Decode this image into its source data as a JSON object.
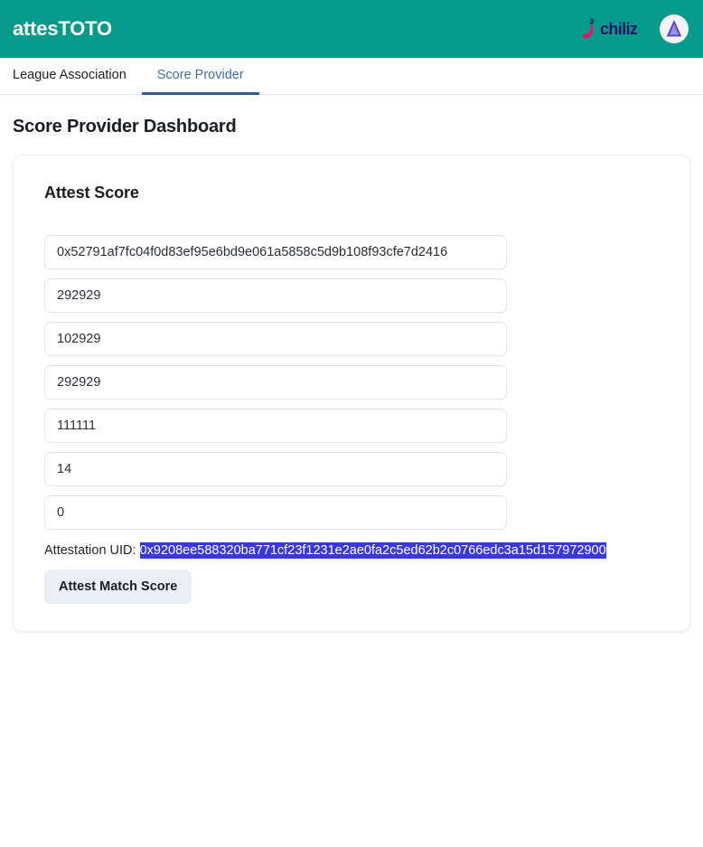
{
  "header": {
    "brand": "attesTOTO",
    "brand_bg_color": "#049b8b",
    "logos": [
      {
        "name": "chiliz-logo",
        "text": "chiliz",
        "mark_color": "#e5165d",
        "text_color": "#1b1464"
      },
      {
        "name": "eas-logo",
        "badge_color": "#f4f3f8",
        "triangle_color": "#6a5acd"
      }
    ]
  },
  "tabs": [
    {
      "label": "League Association",
      "active": false
    },
    {
      "label": "Score Provider",
      "active": true
    }
  ],
  "page": {
    "title": "Score Provider Dashboard"
  },
  "card": {
    "title": "Attest Score",
    "fields": [
      {
        "name": "recipient-address-input",
        "value": "0x52791af7fc04f0d83ef95e6bd9e061a5858c5d9b108f93cfe7d2416",
        "placeholder": ""
      },
      {
        "name": "match-id-input",
        "value": "292929",
        "placeholder": ""
      },
      {
        "name": "league-id-input",
        "value": "102929",
        "placeholder": ""
      },
      {
        "name": "home-team-id-input",
        "value": "292929",
        "placeholder": ""
      },
      {
        "name": "away-team-id-input",
        "value": "111111",
        "placeholder": ""
      },
      {
        "name": "home-score-input",
        "value": "14",
        "placeholder": ""
      },
      {
        "name": "away-score-input",
        "value": "0",
        "placeholder": ""
      }
    ],
    "attestation": {
      "label": "Attestation UID:",
      "uid": "0x9208ee588320ba771cf23f1231e2ae0fa2c5ed62b2c0766edc3a15d157972900",
      "highlight_bg": "#3a38dd",
      "highlight_fg": "#ffffff"
    },
    "submit_label": "Attest Match Score"
  }
}
